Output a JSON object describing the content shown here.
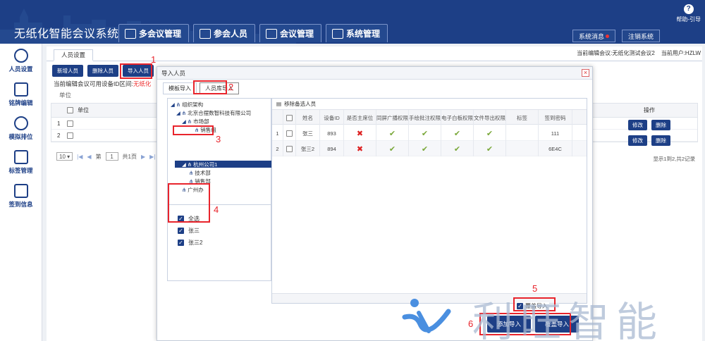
{
  "app": {
    "title": "无纸化智能会议系统",
    "help_label": "帮助-引导",
    "system_message": "系统消息",
    "logout": "注销系统"
  },
  "main_tabs": [
    {
      "label": "多会议管理",
      "icon": "monitor-icon"
    },
    {
      "label": "参会人员",
      "icon": "people-icon"
    },
    {
      "label": "会议管理",
      "icon": "meeting-icon"
    },
    {
      "label": "系统管理",
      "icon": "system-icon"
    }
  ],
  "sidebar": {
    "items": [
      {
        "label": "人员设置",
        "icon": "user-group-icon"
      },
      {
        "label": "铭牌编辑",
        "icon": "edit-icon"
      },
      {
        "label": "模拟排位",
        "icon": "seat-icon"
      },
      {
        "label": "标签管理",
        "icon": "tag-icon"
      },
      {
        "label": "签到信息",
        "icon": "calendar-check-icon"
      }
    ]
  },
  "content": {
    "tab": "人员设置",
    "current_meeting": "当前编辑会议:无纸化测试会议2",
    "current_user": "当前用户:HZLW",
    "buttons": [
      "新增人员",
      "删除人员",
      "导入人员"
    ],
    "hint_prefix": "当前编辑会议可用设备ID区间:",
    "hint_red": "无纸化",
    "unit_label": "单位",
    "grid_header": "单位",
    "row_numbers": [
      "1",
      "2"
    ],
    "ops_header": "操作",
    "edit_label": "修改",
    "delete_label": "删除",
    "page_size": "10",
    "page_prefix": "第",
    "page_no": "1",
    "page_total": "共1页",
    "record_info": "显示1到2,共2记录"
  },
  "modal": {
    "title": "导入人员",
    "close": "×",
    "tabs": [
      "模板导入",
      "人员库导入"
    ],
    "tree": {
      "root": "组织架构",
      "company": "北京合摆数智科技有限公司",
      "market": "市场部",
      "sales_group": "销售组",
      "hangzhou": "杭州公司1",
      "tech": "技术部",
      "sales_dept": "销售部",
      "guangzhou": "广州办"
    },
    "people": [
      {
        "label": "全选",
        "checked": true
      },
      {
        "label": "张三",
        "checked": true
      },
      {
        "label": "张三2",
        "checked": true
      }
    ],
    "remove_label": "移除备选人员",
    "columns": [
      "姓名",
      "设备ID",
      "是否主席位",
      "同屏广播权限",
      "手绘批注权限",
      "电子白板权限",
      "文件导出权限",
      "标签",
      "签到密码"
    ],
    "rows": [
      {
        "no": "1",
        "name": "张三",
        "device_id": "893",
        "chair": false,
        "broadcast": true,
        "annotate": true,
        "whiteboard": true,
        "export": true,
        "tag": "",
        "password": "111"
      },
      {
        "no": "2",
        "name": "张三2",
        "device_id": "894",
        "chair": false,
        "broadcast": true,
        "annotate": true,
        "whiteboard": true,
        "export": true,
        "tag": "",
        "password": "6E4C"
      }
    ],
    "cover_label": "覆盖导入",
    "add_import": "添加导入",
    "cover_import": "覆盖导入"
  },
  "annotations": [
    "1",
    "2",
    "3",
    "4",
    "5",
    "6"
  ],
  "watermark": {
    "text": "利旺智能"
  }
}
